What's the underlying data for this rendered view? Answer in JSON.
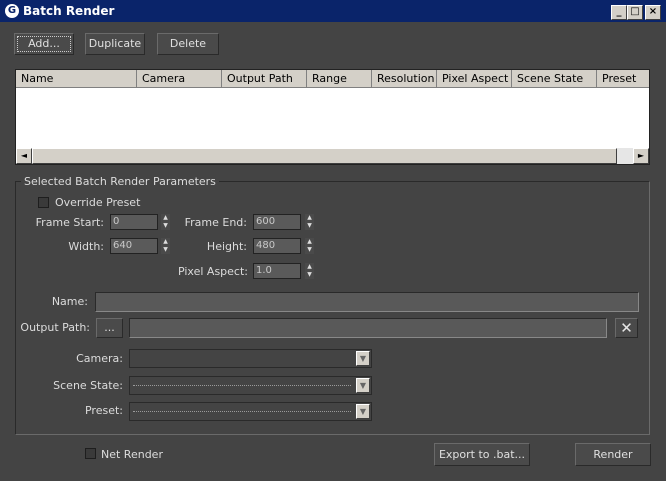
{
  "window": {
    "title": "Batch Render",
    "app_icon": "G",
    "minimize_glyph": "_",
    "maximize_glyph": "□",
    "close_glyph": "×"
  },
  "toolbar": {
    "add_label": "Add...",
    "duplicate_label": "Duplicate",
    "delete_label": "Delete"
  },
  "table": {
    "columns": [
      "Name",
      "Camera",
      "Output Path",
      "Range",
      "Resolution",
      "Pixel Aspect",
      "Scene State",
      "Preset"
    ],
    "rows": [],
    "scroll_left_glyph": "◄",
    "scroll_right_glyph": "►"
  },
  "params": {
    "group_title": "Selected Batch Render Parameters",
    "override_preset_label": "Override Preset",
    "override_preset_checked": false,
    "frame_start_label": "Frame Start:",
    "frame_start_value": "0",
    "frame_end_label": "Frame End:",
    "frame_end_value": "600",
    "width_label": "Width:",
    "width_value": "640",
    "height_label": "Height:",
    "height_value": "480",
    "pixel_aspect_label": "Pixel Aspect:",
    "pixel_aspect_value": "1.0",
    "name_label": "Name:",
    "name_value": "",
    "output_path_label": "Output Path:",
    "output_path_browse": "...",
    "output_path_value": "",
    "clear_glyph": "✕",
    "camera_label": "Camera:",
    "camera_value": "",
    "scene_state_label": "Scene State:",
    "scene_state_value": "",
    "preset_label": "Preset:",
    "preset_value": "",
    "spin_up_glyph": "▲",
    "spin_down_glyph": "▼",
    "combo_glyph": "▼"
  },
  "footer": {
    "net_render_label": "Net Render",
    "net_render_checked": false,
    "export_label": "Export to .bat...",
    "render_label": "Render"
  }
}
